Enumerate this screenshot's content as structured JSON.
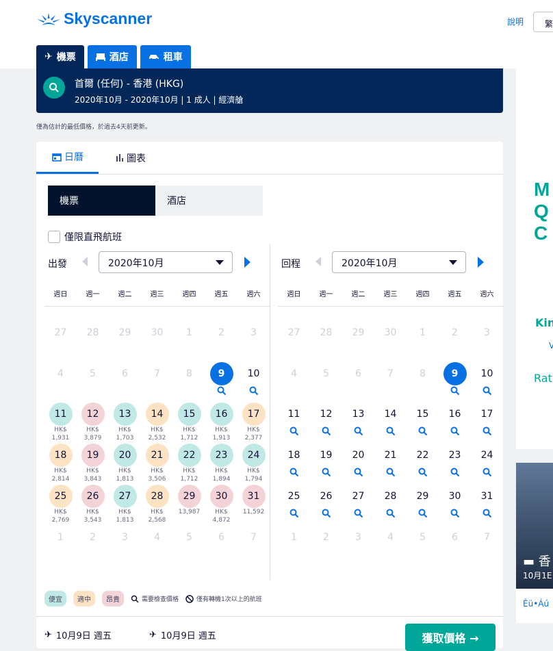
{
  "header": {
    "brand": "Skyscanner",
    "help": "說明",
    "lang": "繁",
    "tabs": [
      {
        "label": "機票",
        "icon": "plane-icon"
      },
      {
        "label": "酒店",
        "icon": "bed-icon"
      },
      {
        "label": "租車",
        "icon": "car-icon"
      }
    ]
  },
  "search": {
    "route": "首爾 (任何) - 香港 (HKG)",
    "details": "2020年10月 - 2020年10月 | 1 成人 | 經濟艙"
  },
  "note": "僅為估計的最低價格，於過去4天前更新。",
  "view_tabs": {
    "calendar": "日曆",
    "chart": "圖表"
  },
  "toggle": {
    "flights": "機票",
    "hotels": "酒店"
  },
  "direct_only": "僅限直飛航班",
  "depart": {
    "label": "出發",
    "month": "2020年10月"
  },
  "return": {
    "label": "回程",
    "month": "2020年10月"
  },
  "weekdays": [
    "週日",
    "週一",
    "週二",
    "週三",
    "週四",
    "週五",
    "週六"
  ],
  "legend": {
    "cheap": "便宜",
    "mid": "適中",
    "exp": "昂貴",
    "check": "需要檢查價格",
    "nodirect": "僅有轉機1次以上的航班"
  },
  "footer": {
    "depart": "10月9日 週五",
    "return": "10月9日 週五",
    "button": "獲取價格 →"
  },
  "ad": {
    "lines": [
      "M",
      "Q",
      "C"
    ],
    "k": "Kin",
    "v": "V",
    "r": "Rat",
    "caption": "香",
    "date": "10月1E",
    "link": "Êü•Áú"
  },
  "colors": {
    "accent": "#0770e3",
    "navy": "#042759",
    "teal": "#00a698",
    "cheap": "#c0e8e4",
    "mid": "#fde3c3",
    "exp": "#f4d3d8"
  }
}
